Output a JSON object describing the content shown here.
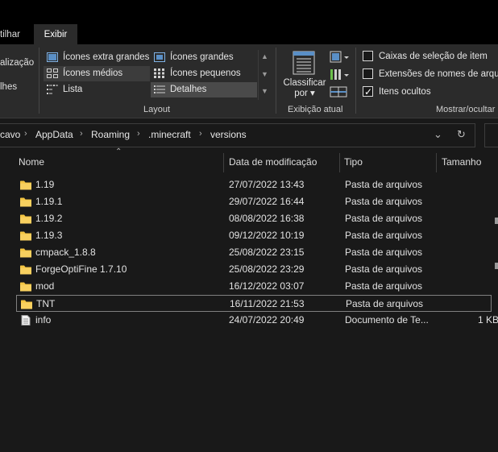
{
  "tabs": {
    "share": "tilhar",
    "view": "Exibir"
  },
  "ribbon": {
    "left_items": [
      "alização",
      "lhes"
    ],
    "layout": {
      "options": [
        {
          "label": "Ícones extra grandes",
          "state": "normal"
        },
        {
          "label": "Ícones grandes",
          "state": "normal"
        },
        {
          "label": "Ícones médios",
          "state": "hover"
        },
        {
          "label": "Ícones pequenos",
          "state": "normal"
        },
        {
          "label": "Lista",
          "state": "normal"
        },
        {
          "label": "Detalhes",
          "state": "selected"
        }
      ],
      "group_label": "Layout"
    },
    "current_view": {
      "sort_label_1": "Classificar",
      "sort_label_2": "por",
      "group_label": "Exibição atual"
    },
    "show_hide": {
      "checkboxes": [
        {
          "label": "Caixas de seleção de item",
          "checked": false
        },
        {
          "label": "Extensões de nomes de arquivos",
          "checked": false
        },
        {
          "label": "Itens ocultos",
          "checked": true
        }
      ],
      "group_label": "Mostrar/ocultar"
    }
  },
  "address": {
    "crumbs": [
      "cavo",
      "AppData",
      "Roaming",
      ".minecraft",
      "versions"
    ]
  },
  "columns": {
    "name": "Nome",
    "date": "Data de modificação",
    "type": "Tipo",
    "size": "Tamanho"
  },
  "files": [
    {
      "name": "1.19",
      "date": "27/07/2022 13:43",
      "type": "Pasta de arquivos",
      "size": "",
      "kind": "folder"
    },
    {
      "name": "1.19.1",
      "date": "29/07/2022 16:44",
      "type": "Pasta de arquivos",
      "size": "",
      "kind": "folder"
    },
    {
      "name": "1.19.2",
      "date": "08/08/2022 16:38",
      "type": "Pasta de arquivos",
      "size": "",
      "kind": "folder"
    },
    {
      "name": "1.19.3",
      "date": "09/12/2022 10:19",
      "type": "Pasta de arquivos",
      "size": "",
      "kind": "folder"
    },
    {
      "name": "cmpack_1.8.8",
      "date": "25/08/2022 23:15",
      "type": "Pasta de arquivos",
      "size": "",
      "kind": "folder"
    },
    {
      "name": "ForgeOptiFine 1.7.10",
      "date": "25/08/2022 23:29",
      "type": "Pasta de arquivos",
      "size": "",
      "kind": "folder"
    },
    {
      "name": "mod",
      "date": "16/12/2022 03:07",
      "type": "Pasta de arquivos",
      "size": "",
      "kind": "folder"
    },
    {
      "name": "TNT",
      "date": "16/11/2022 21:53",
      "type": "Pasta de arquivos",
      "size": "",
      "kind": "folder"
    },
    {
      "name": "info",
      "date": "24/07/2022 20:49",
      "type": "Documento de Te...",
      "size": "1 KB",
      "kind": "document"
    }
  ],
  "colors": {
    "background": "#191919",
    "ribbon": "#2b2b2b",
    "folder": "#f4c542",
    "text": "#e6e6e6"
  }
}
